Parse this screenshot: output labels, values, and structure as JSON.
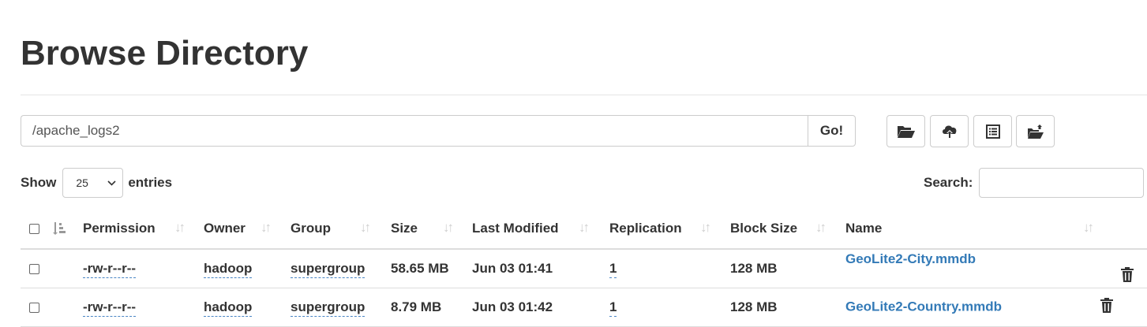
{
  "page": {
    "title": "Browse Directory"
  },
  "pathbar": {
    "path": "/apache_logs2",
    "go_label": "Go!"
  },
  "toolbar": [
    {
      "name": "create-directory-button",
      "icon": "folder-open-icon"
    },
    {
      "name": "upload-button",
      "icon": "cloud-upload-icon"
    },
    {
      "name": "cut-button",
      "icon": "list-alt-icon"
    },
    {
      "name": "paste-button",
      "icon": "folder-paste-icon"
    }
  ],
  "length": {
    "show_label": "Show",
    "value": "25",
    "entries_label": "entries"
  },
  "search": {
    "label": "Search:",
    "value": ""
  },
  "table": {
    "columns": [
      "Permission",
      "Owner",
      "Group",
      "Size",
      "Last Modified",
      "Replication",
      "Block Size",
      "Name"
    ],
    "rows": [
      {
        "permission": "-rw-r--r--",
        "owner": "hadoop",
        "group": "supergroup",
        "size": "58.65 MB",
        "modified": "Jun 03 01:41",
        "replication": "1",
        "block_size": "128 MB",
        "name": "GeoLite2-City.mmdb"
      },
      {
        "permission": "-rw-r--r--",
        "owner": "hadoop",
        "group": "supergroup",
        "size": "8.79 MB",
        "modified": "Jun 03 01:42",
        "replication": "1",
        "block_size": "128 MB",
        "name": "GeoLite2-Country.mmdb"
      }
    ]
  },
  "colors": {
    "link": "#337ab7",
    "text": "#333333",
    "border": "#dddddd"
  }
}
